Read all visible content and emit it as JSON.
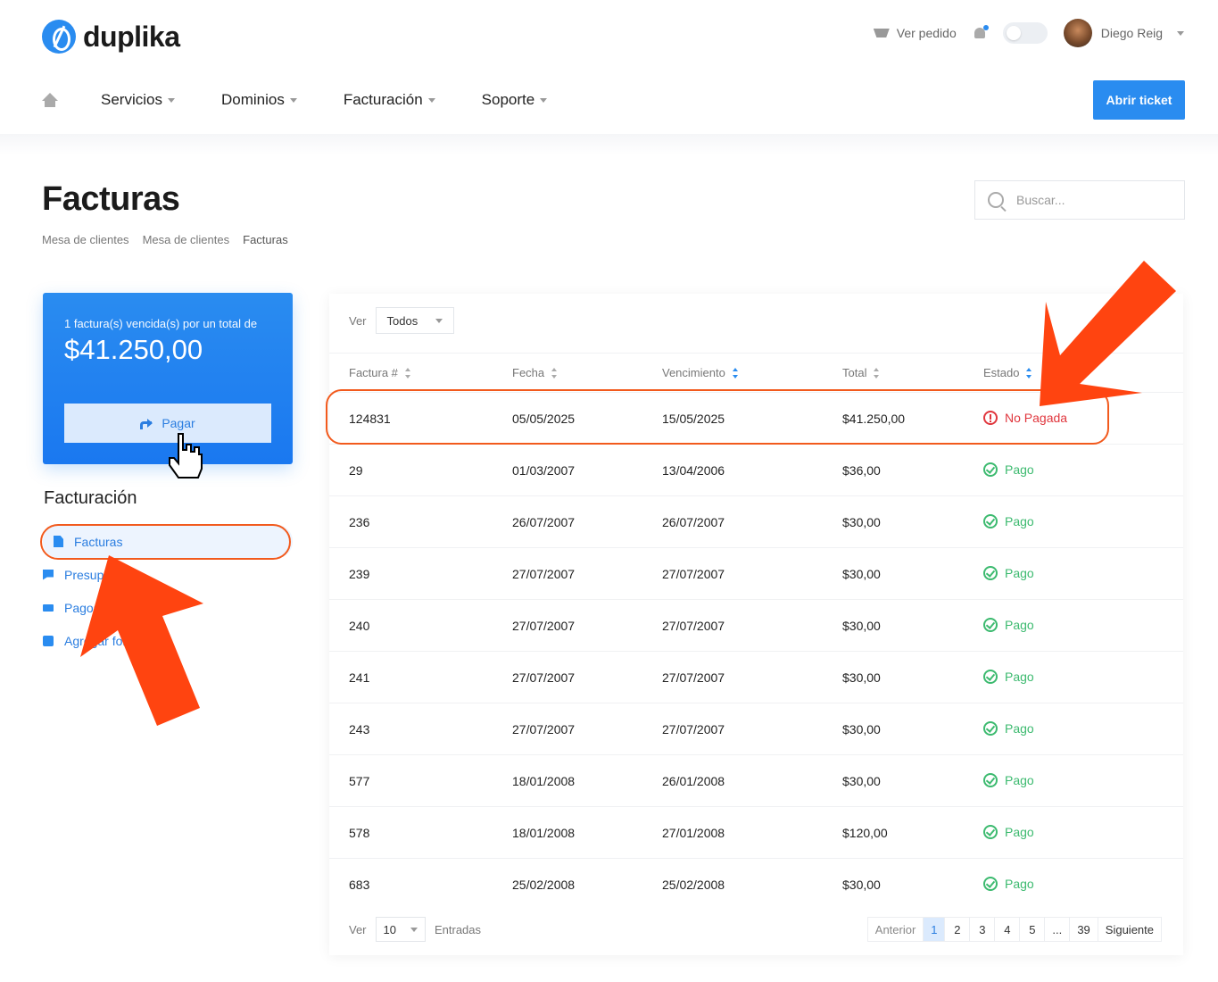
{
  "brand": {
    "name": "duplika",
    "color": "#2a8cf0"
  },
  "header": {
    "cart_label": "Ver pedido",
    "user_name": "Diego Reig",
    "nav": [
      {
        "label": "Servicios"
      },
      {
        "label": "Dominios"
      },
      {
        "label": "Facturación"
      },
      {
        "label": "Soporte"
      }
    ],
    "ticket_button": "Abrir ticket"
  },
  "page": {
    "title": "Facturas",
    "breadcrumb": [
      "Mesa de clientes",
      "Mesa de clientes",
      "Facturas"
    ],
    "search_placeholder": "Buscar..."
  },
  "sidebar": {
    "due_label": "1 factura(s) vencida(s) por un total de",
    "due_amount": "$41.250,00",
    "pay_button": "Pagar",
    "heading": "Facturación",
    "items": [
      {
        "label": "Facturas",
        "icon": "document-icon",
        "active": true
      },
      {
        "label": "Presupuestos",
        "icon": "chat-icon"
      },
      {
        "label": "Pagos",
        "icon": "money-icon"
      },
      {
        "label": "Agregar fondos",
        "icon": "plus-icon"
      }
    ]
  },
  "table": {
    "filter_label": "Ver",
    "filter_value": "Todos",
    "columns": [
      "Factura #",
      "Fecha",
      "Vencimiento",
      "Total",
      "Estado"
    ],
    "rows": [
      {
        "id": "124831",
        "date": "05/05/2025",
        "due": "15/05/2025",
        "total": "$41.250,00",
        "status": "No Pagada",
        "paid": false
      },
      {
        "id": "29",
        "date": "01/03/2007",
        "due": "13/04/2006",
        "total": "$36,00",
        "status": "Pago",
        "paid": true
      },
      {
        "id": "236",
        "date": "26/07/2007",
        "due": "26/07/2007",
        "total": "$30,00",
        "status": "Pago",
        "paid": true
      },
      {
        "id": "239",
        "date": "27/07/2007",
        "due": "27/07/2007",
        "total": "$30,00",
        "status": "Pago",
        "paid": true
      },
      {
        "id": "240",
        "date": "27/07/2007",
        "due": "27/07/2007",
        "total": "$30,00",
        "status": "Pago",
        "paid": true
      },
      {
        "id": "241",
        "date": "27/07/2007",
        "due": "27/07/2007",
        "total": "$30,00",
        "status": "Pago",
        "paid": true
      },
      {
        "id": "243",
        "date": "27/07/2007",
        "due": "27/07/2007",
        "total": "$30,00",
        "status": "Pago",
        "paid": true
      },
      {
        "id": "577",
        "date": "18/01/2008",
        "due": "26/01/2008",
        "total": "$30,00",
        "status": "Pago",
        "paid": true
      },
      {
        "id": "578",
        "date": "18/01/2008",
        "due": "27/01/2008",
        "total": "$120,00",
        "status": "Pago",
        "paid": true
      },
      {
        "id": "683",
        "date": "25/02/2008",
        "due": "25/02/2008",
        "total": "$30,00",
        "status": "Pago",
        "paid": true
      }
    ],
    "length_label": "Ver",
    "length_value": "10",
    "length_suffix": "Entradas",
    "pagination": [
      "Anterior",
      "1",
      "2",
      "3",
      "4",
      "5",
      "...",
      "39",
      "Siguiente"
    ],
    "current_page": "1"
  },
  "colors": {
    "paid": "#3cba6f",
    "unpaid": "#e0363d",
    "annotation": "#f25a1d"
  }
}
